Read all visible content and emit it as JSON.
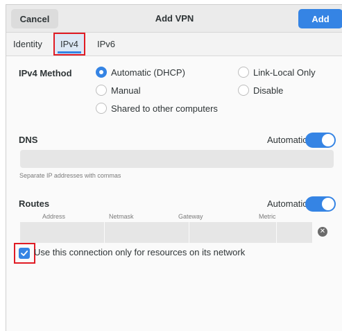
{
  "header": {
    "cancel_label": "Cancel",
    "title": "Add VPN",
    "add_label": "Add"
  },
  "tabs": [
    {
      "label": "Identity"
    },
    {
      "label": "IPv4"
    },
    {
      "label": "IPv6"
    }
  ],
  "active_tab": "IPv4",
  "ipv4_method": {
    "label": "IPv4 Method",
    "options": [
      {
        "label": "Automatic (DHCP)",
        "selected": true
      },
      {
        "label": "Link-Local Only",
        "selected": false
      },
      {
        "label": "Manual",
        "selected": false
      },
      {
        "label": "Disable",
        "selected": false
      },
      {
        "label": "Shared to other computers",
        "selected": false
      }
    ]
  },
  "dns": {
    "label": "DNS",
    "automatic_label": "Automatic",
    "automatic_on": true,
    "value": "",
    "hint": "Separate IP addresses with commas"
  },
  "routes": {
    "label": "Routes",
    "automatic_label": "Automatic",
    "automatic_on": true,
    "columns": [
      "Address",
      "Netmask",
      "Gateway",
      "Metric"
    ],
    "rows": [
      {
        "address": "",
        "netmask": "",
        "gateway": "",
        "metric": ""
      }
    ]
  },
  "restrict": {
    "label": "Use this connection only for resources on its network",
    "checked": true
  },
  "colors": {
    "accent": "#3584e4",
    "highlight": "#e01b24"
  }
}
